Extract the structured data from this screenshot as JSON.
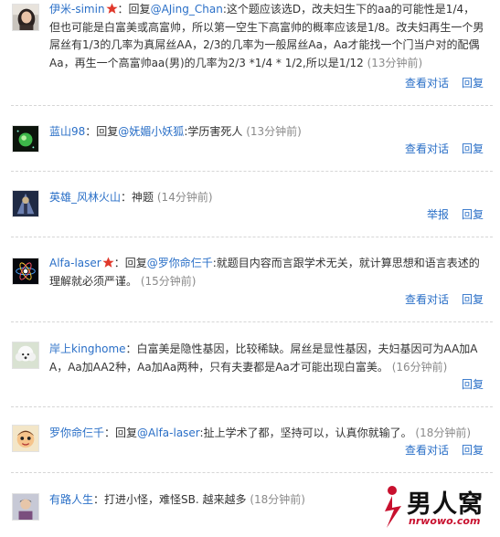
{
  "comments": [
    {
      "user": "伊米-simin",
      "vip": true,
      "reply_prefix": "：回复",
      "mention": "@AJing_Chan",
      "content": ":这个题应该选D，改夫妇生下的aa的可能性是1/4，但也可能是白富美或高富帅，所以第一空生下高富帅的概率应该是1/8。改夫妇再生一个男屌丝有1/3的几率为真屌丝AA，2/3的几率为一般屌丝Aa，Aa才能找一个门当户对的配偶Aa，再生一个高富帅aa(男)的几率为2/3 *1/4 * 1/2,所以是1/12",
      "time": "(13分钟前)",
      "actions": [
        "查看对话",
        "回复"
      ],
      "avatar_icon": "avatar-girl-icon"
    },
    {
      "user": "蓝山98",
      "vip": false,
      "reply_prefix": "：回复",
      "mention": "@妩媚小妖狐",
      "content": ":学历害死人",
      "time": "(13分钟前)",
      "actions": [
        "查看对话",
        "回复"
      ],
      "avatar_icon": "avatar-green-orb-icon"
    },
    {
      "user": "英雄_风林火山",
      "vip": false,
      "reply_prefix": "：",
      "mention": "",
      "content": "神题",
      "time": "(14分钟前)",
      "actions": [
        "举报",
        "回复"
      ],
      "avatar_icon": "avatar-warrior-icon"
    },
    {
      "user": "Alfa-laser",
      "vip": true,
      "reply_prefix": "：回复",
      "mention": "@罗你命仨千",
      "content": ":就题目内容而言跟学术无关，就计算思想和语言表述的理解就必须严谨。",
      "time": "(15分钟前)",
      "actions": [
        "查看对话",
        "回复"
      ],
      "avatar_icon": "avatar-atom-icon"
    },
    {
      "user": "岸上kinghome",
      "vip": false,
      "reply_prefix": "：",
      "mention": "",
      "content": "白富美是隐性基因，比较稀缺。屌丝是显性基因，夫妇基因可为AA加AA，Aa加AA2种，Aa加Aa两种，只有夫妻都是Aa才可能出现白富美。",
      "time": "(16分钟前)",
      "actions": [
        "回复"
      ],
      "avatar_icon": "avatar-poodle-icon"
    },
    {
      "user": "罗你命仨千",
      "vip": false,
      "reply_prefix": "：回复",
      "mention": "@Alfa-laser",
      "content": ":扯上学术了都，坚持可以，认真你就输了。",
      "time": "(18分钟前)",
      "actions": [
        "查看对话",
        "回复"
      ],
      "avatar_icon": "avatar-cartoon-icon"
    },
    {
      "user": "有路人生",
      "vip": false,
      "reply_prefix": "：",
      "mention": "",
      "content": "打进小怪，难怪SB. 越来越多",
      "time": "(18分钟前)",
      "actions": [],
      "avatar_icon": "avatar-person-icon"
    }
  ],
  "watermark": {
    "text": "男人窝",
    "url": "nrwowo.com"
  },
  "colors": {
    "link": "#2a6fc7",
    "text": "#333333",
    "time": "#8a8a8a",
    "separator": "#d6d6d6",
    "vip_star": "#e0382b",
    "watermark_red": "#c8102e"
  }
}
